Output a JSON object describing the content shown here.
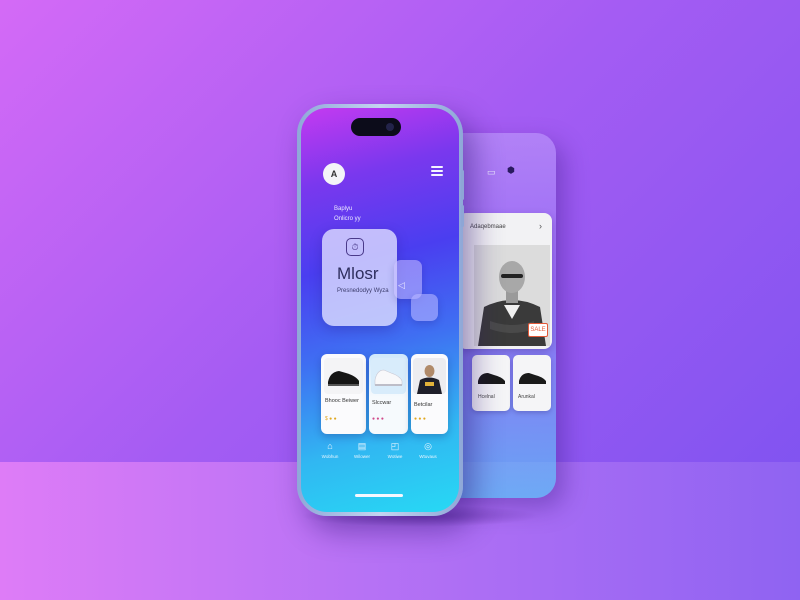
{
  "scene": {
    "background": "#a45cf3",
    "accent_colors": [
      "#d46af6",
      "#7a52f0",
      "#27d9f4"
    ]
  },
  "phone_main": {
    "avatar_letter": "A",
    "menu_icon": "menu-icon",
    "greeting_line1": "Baplyu",
    "greeting_line2": "Onlicro yy",
    "feature_card": {
      "icon": "timer-icon",
      "title": "Mlosr",
      "subtitle": "Presnedodyy Wyza"
    },
    "products": [
      {
        "name": "Bhooc Beiwer",
        "meta": "$ ● ●"
      },
      {
        "name": "Slccwar",
        "meta": "● ● ●"
      },
      {
        "name": "Betcilar",
        "meta": "● ● ●"
      }
    ],
    "tabs": [
      {
        "icon": "home-icon",
        "label": "Wobhun"
      },
      {
        "icon": "bookmark-icon",
        "label": "Wilower"
      },
      {
        "icon": "bag-icon",
        "label": "Wotiwe"
      },
      {
        "icon": "settings-icon",
        "label": "Wtuvaus"
      }
    ]
  },
  "phone_back": {
    "header_title": "Adaqebmaae",
    "badge_text": "SALE",
    "tiles": [
      {
        "name": "Hcelnal"
      },
      {
        "name": "Arunkal"
      }
    ]
  }
}
